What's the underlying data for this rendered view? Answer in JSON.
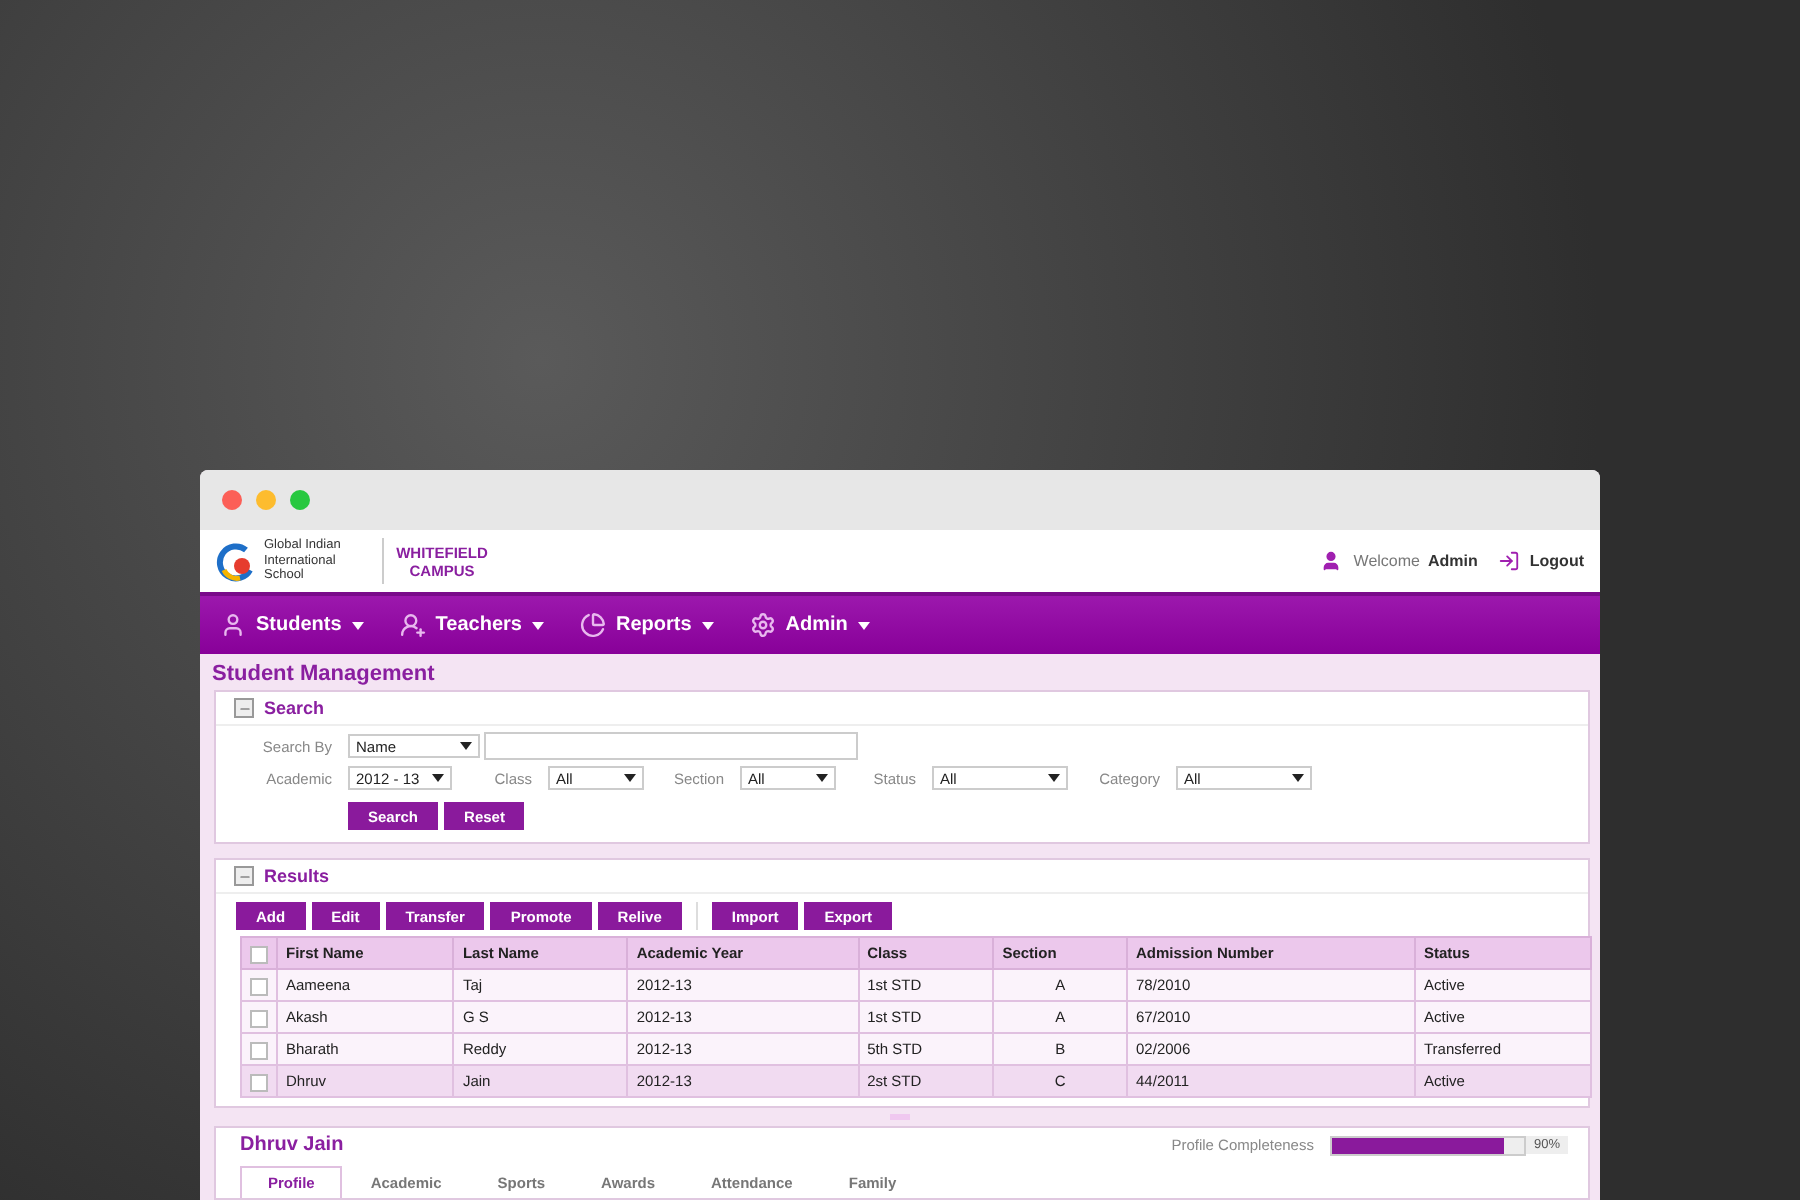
{
  "header": {
    "logo_text": "Global Indian International School",
    "campus": "WHITEFIELD CAMPUS",
    "welcome": "Welcome",
    "user": "Admin",
    "logout": "Logout"
  },
  "nav": [
    {
      "label": "Students"
    },
    {
      "label": "Teachers"
    },
    {
      "label": "Reports"
    },
    {
      "label": "Admin"
    }
  ],
  "page_title": "Student Management",
  "search": {
    "title": "Search",
    "search_by_label": "Search By",
    "search_by_value": "Name",
    "filters": [
      {
        "label": "Academic",
        "value": "2012 - 13"
      },
      {
        "label": "Class",
        "value": "All"
      },
      {
        "label": "Section",
        "value": "All"
      },
      {
        "label": "Status",
        "value": "All"
      },
      {
        "label": "Category",
        "value": "All"
      }
    ],
    "buttons": [
      "Search",
      "Reset"
    ]
  },
  "results": {
    "title": "Results",
    "actions": [
      "Add",
      "Edit",
      "Transfer",
      "Promote",
      "Relive"
    ],
    "io_actions": [
      "Import",
      "Export"
    ],
    "table": {
      "all_checked": false,
      "columns": [
        "First Name",
        "Last Name",
        "Academic Year",
        "Class",
        "Section",
        "Admission Number",
        "Status"
      ],
      "rows": [
        {
          "cells": [
            "Aameena",
            "Taj",
            "2012-13",
            "1st STD",
            "A",
            "78/2010",
            "Active"
          ],
          "checked": false,
          "selected": false
        },
        {
          "cells": [
            "Akash",
            "G S",
            "2012-13",
            "1st STD",
            "A",
            "67/2010",
            "Active"
          ],
          "checked": false,
          "selected": false
        },
        {
          "cells": [
            "Bharath",
            "Reddy",
            "2012-13",
            "5th STD",
            "B",
            "02/2006",
            "Transferred"
          ],
          "checked": false,
          "selected": false
        },
        {
          "cells": [
            "Dhruv",
            "Jain",
            "2012-13",
            "2st STD",
            "C",
            "44/2011",
            "Active"
          ],
          "checked": false,
          "selected": true
        }
      ]
    }
  },
  "profile": {
    "name": "Dhruv Jain",
    "completeness_label": "Profile Completeness",
    "level": 0.9,
    "reading": "90%",
    "tabs": [
      {
        "label": "Profile",
        "selected": true
      },
      {
        "label": "Academic",
        "selected": false
      },
      {
        "label": "Sports",
        "selected": false
      },
      {
        "label": "Awards",
        "selected": false
      },
      {
        "label": "Attendance",
        "selected": false
      },
      {
        "label": "Family",
        "selected": false
      }
    ]
  }
}
